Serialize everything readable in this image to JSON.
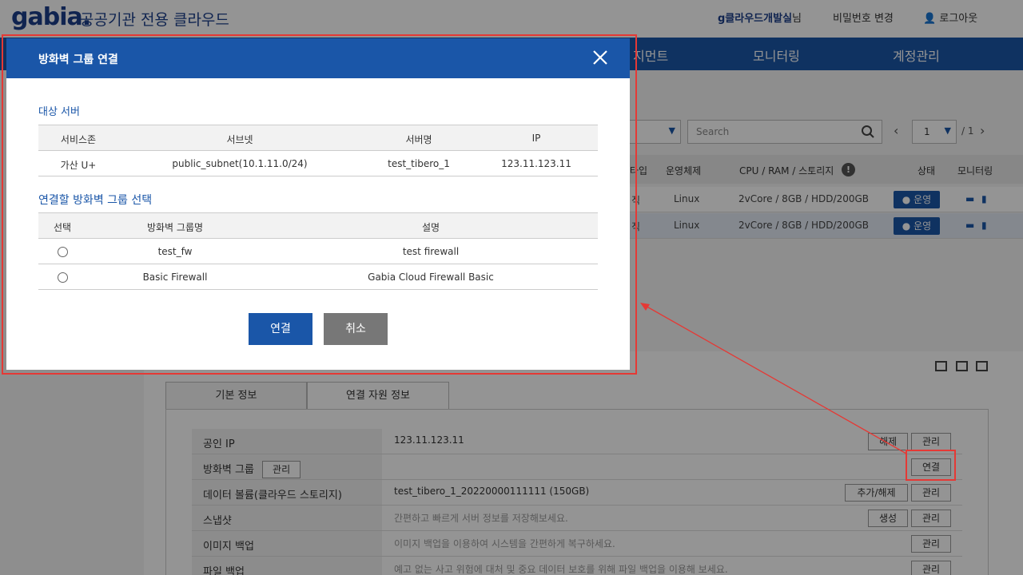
{
  "header": {
    "logo": "gabia.",
    "brand_sub": "공공기관 전용 클라우드",
    "user_name": "g클라우드개발실",
    "user_suffix": "님",
    "password_change": "비밀번호 변경",
    "logout": "로그아웃"
  },
  "nav": {
    "items": [
      {
        "label": "지먼트"
      },
      {
        "label": "모니터링"
      },
      {
        "label": "계정관리"
      }
    ]
  },
  "toolbar": {
    "search_placeholder": "Search",
    "page_current": "1",
    "page_total": "/ 1"
  },
  "server_table": {
    "headers": [
      "타입",
      "운영체제",
      "CPU / RAM / 스토리지",
      "상태",
      "모니터링"
    ],
    "rows": [
      {
        "type_partial": "직",
        "os": "Linux",
        "spec": "2vCore / 8GB / HDD/200GB",
        "status": "운영"
      },
      {
        "type_partial": "직",
        "os": "Linux",
        "spec": "2vCore / 8GB / HDD/200GB",
        "status": "운영"
      }
    ]
  },
  "detail": {
    "tabs": [
      {
        "label": "기본 정보"
      },
      {
        "label": "연결 자원 정보"
      }
    ],
    "rows": [
      {
        "label": "공인 IP",
        "value": "123.11.123.11",
        "buttons": [
          "해제",
          "관리"
        ]
      },
      {
        "label": "방화벽 그룹",
        "label_button": "관리",
        "value": "",
        "buttons": [
          "연결"
        ]
      },
      {
        "label": "데이터 볼륨(클라우드 스토리지)",
        "value": "test_tibero_1_20220000111111 (150GB)",
        "buttons": [
          "추가/해제",
          "관리"
        ]
      },
      {
        "label": "스냅샷",
        "value": "간편하고 빠르게 서버 정보를 저장해보세요.",
        "buttons": [
          "생성",
          "관리"
        ]
      },
      {
        "label": "이미지 백업",
        "value": "이미지 백업을 이용하여 시스템을 간편하게 복구하세요.",
        "buttons": [
          "관리"
        ]
      },
      {
        "label": "파일 백업",
        "value": "예고 없는 사고 위험에 대처 및 중요 데이터 보호를 위해 파일 백업을 이용해 보세요.",
        "buttons": [
          "관리"
        ]
      }
    ]
  },
  "modal": {
    "title": "방화벽 그룹 연결",
    "close_icon": "close-icon",
    "target_section": "대상 서버",
    "target_headers": [
      "서비스존",
      "서브넷",
      "서버명",
      "IP"
    ],
    "target_row": [
      "가산 U+",
      "public_subnet(10.1.11.0/24)",
      "test_tibero_1",
      "123.11.123.11"
    ],
    "fw_section": "연결할 방화벽 그룹 선택",
    "fw_headers": [
      "선택",
      "방화벽 그룹명",
      "설명"
    ],
    "fw_rows": [
      {
        "name": "test_fw",
        "desc": "test firewall"
      },
      {
        "name": "Basic Firewall",
        "desc": "Gabia Cloud Firewall Basic"
      }
    ],
    "connect_label": "연결",
    "cancel_label": "취소"
  },
  "colors": {
    "primary": "#1a56a8",
    "annotation": "#e53935",
    "cancel": "#777777"
  }
}
